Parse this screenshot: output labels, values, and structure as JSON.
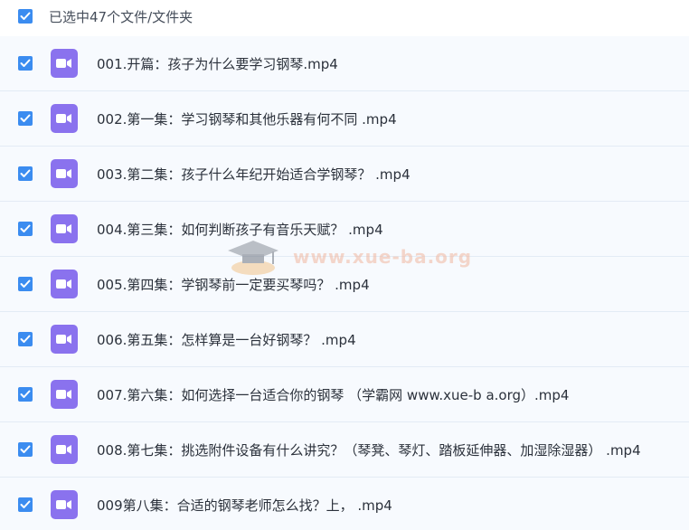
{
  "header": {
    "summary": "已选中47个文件/文件夹"
  },
  "files": [
    {
      "name": "001.开篇：孩子为什么要学习钢琴.mp4",
      "checked": true,
      "icon": "video-icon"
    },
    {
      "name": "002.第一集：学习钢琴和其他乐器有何不同 .mp4",
      "checked": true,
      "icon": "video-icon"
    },
    {
      "name": "003.第二集：孩子什么年纪开始适合学钢琴？ .mp4",
      "checked": true,
      "icon": "video-icon"
    },
    {
      "name": "004.第三集：如何判断孩子有音乐天赋？ .mp4",
      "checked": true,
      "icon": "video-icon"
    },
    {
      "name": "005.第四集：学钢琴前一定要买琴吗？ .mp4",
      "checked": true,
      "icon": "video-icon"
    },
    {
      "name": "006.第五集：怎样算是一台好钢琴？ .mp4",
      "checked": true,
      "icon": "video-icon"
    },
    {
      "name": "007.第六集：如何选择一台适合你的钢琴 （学霸网 www.xue-b a.org）.mp4",
      "checked": true,
      "icon": "video-icon"
    },
    {
      "name": "008.第七集：挑选附件设备有什么讲究？（琴凳、琴灯、踏板延伸器、加湿除湿器） .mp4",
      "checked": true,
      "icon": "video-icon"
    },
    {
      "name": "009第八集：合适的钢琴老师怎么找？上， .mp4",
      "checked": true,
      "icon": "video-icon"
    }
  ],
  "watermark": {
    "text": "www.xue-ba.org"
  },
  "colors": {
    "checkbox": "#3b8cf0",
    "video_icon": "#8a72ee",
    "row_background": "#f7fafe"
  }
}
